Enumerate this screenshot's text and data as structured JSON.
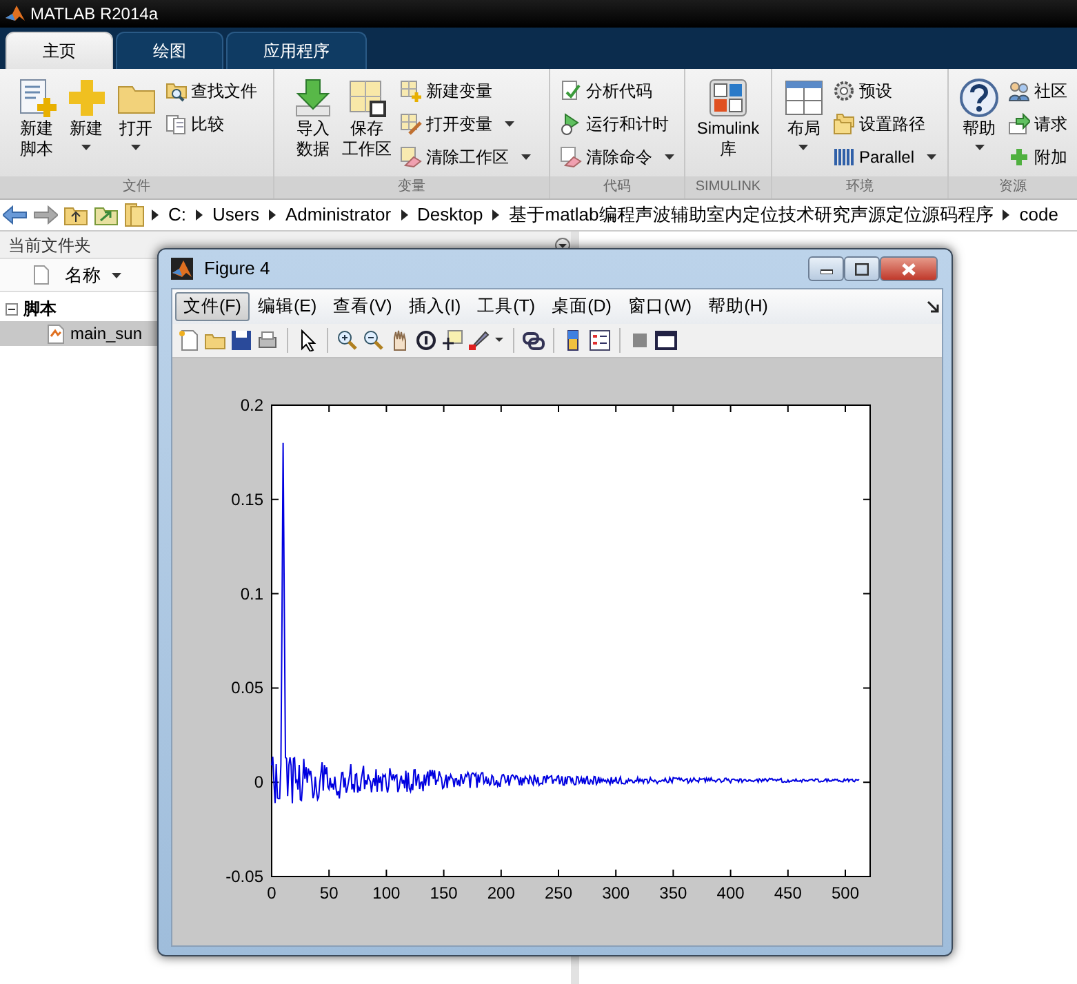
{
  "app": {
    "title": "MATLAB R2014a"
  },
  "tabs": [
    {
      "label": "主页",
      "selected": true
    },
    {
      "label": "绘图",
      "selected": false
    },
    {
      "label": "应用程序",
      "selected": false
    }
  ],
  "ribbon": [
    {
      "label": "文件",
      "items": [
        {
          "kind": "large",
          "label": [
            "新建",
            "脚本"
          ],
          "dropdown": false
        },
        {
          "kind": "large",
          "label": [
            "新建"
          ],
          "dropdown": true
        },
        {
          "kind": "large",
          "label": [
            "打开"
          ],
          "dropdown": true
        },
        {
          "kind": "stack",
          "items": [
            {
              "label": "查找文件",
              "dropdown": false
            },
            {
              "label": "比较",
              "dropdown": false
            }
          ]
        }
      ]
    },
    {
      "label": "变量",
      "items": [
        {
          "kind": "large",
          "label": [
            "导入",
            "数据"
          ],
          "dropdown": false
        },
        {
          "kind": "large",
          "label": [
            "保存",
            "工作区"
          ],
          "dropdown": false
        },
        {
          "kind": "stack",
          "items": [
            {
              "label": "新建变量",
              "dropdown": false
            },
            {
              "label": "打开变量",
              "dropdown": true
            },
            {
              "label": "清除工作区",
              "dropdown": true
            }
          ]
        }
      ]
    },
    {
      "label": "代码",
      "items": [
        {
          "kind": "stack",
          "items": [
            {
              "label": "分析代码",
              "dropdown": false
            },
            {
              "label": "运行和计时",
              "dropdown": false
            },
            {
              "label": "清除命令",
              "dropdown": true
            }
          ]
        }
      ]
    },
    {
      "label": "SIMULINK",
      "items": [
        {
          "kind": "large",
          "label": [
            "Simulink",
            "库"
          ],
          "dropdown": false
        }
      ]
    },
    {
      "label": "环境",
      "items": [
        {
          "kind": "large",
          "label": [
            "布局"
          ],
          "dropdown": true
        },
        {
          "kind": "stack",
          "items": [
            {
              "label": "预设",
              "dropdown": false
            },
            {
              "label": "设置路径",
              "dropdown": false
            },
            {
              "label": "Parallel",
              "dropdown": true
            }
          ]
        }
      ]
    },
    {
      "label": "资源",
      "items": [
        {
          "kind": "large",
          "label": [
            "帮助"
          ],
          "dropdown": true
        },
        {
          "kind": "stack",
          "items": [
            {
              "label": "社区",
              "dropdown": false
            },
            {
              "label": "请求",
              "dropdown": false
            },
            {
              "label": "附加",
              "dropdown": false
            }
          ]
        }
      ]
    }
  ],
  "address": {
    "path": [
      "C:",
      "Users",
      "Administrator",
      "Desktop",
      "基于matlab编程声波辅助室内定位技术研究声源定位源码程序",
      "code"
    ]
  },
  "folder_panel": {
    "title": "当前文件夹",
    "column": "名称",
    "tree": [
      {
        "label": "脚本",
        "expanded": true,
        "children": [
          {
            "label": "main_sun",
            "selected": true
          }
        ]
      }
    ]
  },
  "figure": {
    "title": "Figure 4",
    "menu": [
      {
        "label": "文件(F)",
        "selected": true
      },
      {
        "label": "编辑(E)",
        "selected": false
      },
      {
        "label": "查看(V)",
        "selected": false
      },
      {
        "label": "插入(I)",
        "selected": false
      },
      {
        "label": "工具(T)",
        "selected": false
      },
      {
        "label": "桌面(D)",
        "selected": false
      },
      {
        "label": "窗口(W)",
        "selected": false
      },
      {
        "label": "帮助(H)",
        "selected": false
      }
    ],
    "plot": {
      "yticks": [
        "0.2",
        "0.15",
        "0.1",
        "0.05",
        "0",
        "-0.05"
      ],
      "xticks": [
        "0",
        "50",
        "100",
        "150",
        "200",
        "250",
        "300",
        "350",
        "400",
        "450",
        "500"
      ]
    }
  }
}
